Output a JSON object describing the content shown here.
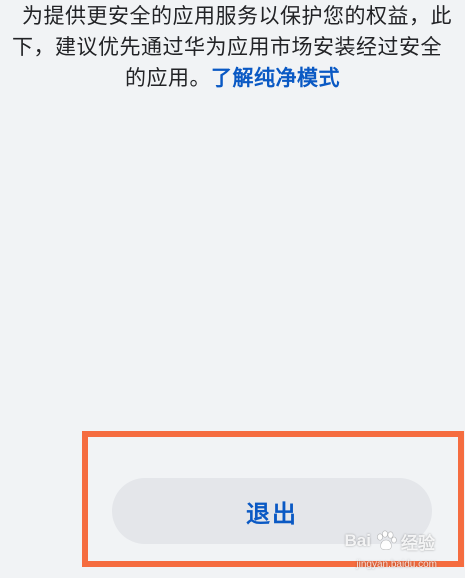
{
  "message": {
    "line1": "为提供更安全的应用服务以保护您的权益，此",
    "line2": "下，建议优先通过华为应用市场安装经过安全",
    "line3_prefix": "的应用。",
    "link_text": "了解纯净模式"
  },
  "actions": {
    "exit_label": "退出"
  },
  "watermark": {
    "brand_left": "Bai",
    "brand_right": "经验",
    "domain": "jingyan.baidu.com"
  },
  "colors": {
    "background": "#f1f3f5",
    "link": "#0a59c4",
    "button_bg": "#e4e6ea",
    "highlight": "#f56c3f"
  }
}
